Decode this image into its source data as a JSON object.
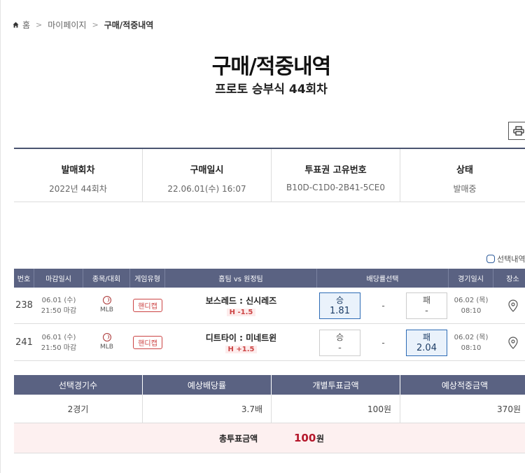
{
  "breadcrumb": {
    "home": "홈",
    "mypage": "마이페이지",
    "current": "구매/적중내역"
  },
  "title": "구매/적중내역",
  "subtitle": "프로토 승부식 44회차",
  "info": [
    {
      "label": "발매회차",
      "value": "2022년 44회차"
    },
    {
      "label": "구매일시",
      "value": "22.06.01(수) 16:07"
    },
    {
      "label": "투표권 고유번호",
      "value": "B10D-C1D0-2B41-5CE0"
    },
    {
      "label": "상태",
      "value": "발매중"
    }
  ],
  "select_toggle_label": "선택내역",
  "game_table": {
    "headers": [
      "번호",
      "마감일시",
      "종목/대회",
      "게임유형",
      "홈팀 vs 원정팀",
      "배당률선택",
      "경기일시",
      "장소"
    ],
    "rows": [
      {
        "no": "238",
        "deadline_date": "06.01 (수)",
        "deadline_time": "21:50 마감",
        "league": "MLB",
        "type": "핸디캡",
        "teams": "보스레드 : 신시레즈",
        "handicap": "H -1.5",
        "win_label": "승",
        "win_odds": "1.81",
        "draw": "-",
        "lose_label": "패",
        "lose_odds": "-",
        "selected": "win",
        "game_date": "06.02 (목)",
        "game_time": "08:10"
      },
      {
        "no": "241",
        "deadline_date": "06.01 (수)",
        "deadline_time": "21:50 마감",
        "league": "MLB",
        "type": "핸디캡",
        "teams": "디트타이 : 미네트윈",
        "handicap": "H +1.5",
        "win_label": "승",
        "win_odds": "-",
        "draw": "-",
        "lose_label": "패",
        "lose_odds": "2.04",
        "selected": "lose",
        "game_date": "06.02 (목)",
        "game_time": "08:10"
      }
    ]
  },
  "summary": {
    "headers": [
      "선택경기수",
      "예상배당률",
      "개별투표금액",
      "예상적중금액"
    ],
    "values": [
      "2경기",
      "3.7배",
      "100원",
      "370원"
    ],
    "total_label": "총투표금액",
    "total_value": "100",
    "total_unit": "원"
  },
  "colors": {
    "header_bg": "#5a6282",
    "selected_border": "#2d6bb5",
    "accent_red": "#b5172b"
  },
  "icons": {
    "home": "home-icon",
    "print": "print-icon",
    "location": "map-pin-icon",
    "sport": "baseball-icon"
  }
}
